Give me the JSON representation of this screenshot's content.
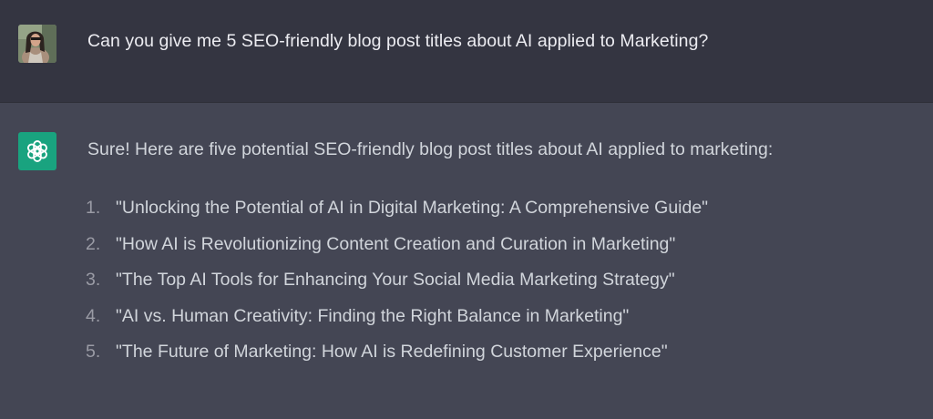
{
  "conversation": {
    "user_message": {
      "avatar": "user-photo-avatar",
      "text": "Can you give me 5 SEO-friendly blog post titles about AI applied to Marketing?"
    },
    "assistant_message": {
      "avatar": "openai-logo-icon",
      "intro": "Sure! Here are five potential SEO-friendly blog post titles about AI applied to marketing:",
      "items": [
        {
          "number": "1.",
          "text": "\"Unlocking the Potential of AI in Digital Marketing: A Comprehensive Guide\""
        },
        {
          "number": "2.",
          "text": "\"How AI is Revolutionizing Content Creation and Curation in Marketing\""
        },
        {
          "number": "3.",
          "text": "\"The Top AI Tools for Enhancing Your Social Media Marketing Strategy\""
        },
        {
          "number": "4.",
          "text": "\"AI vs. Human Creativity: Finding the Right Balance in Marketing\""
        },
        {
          "number": "5.",
          "text": "\"The Future of Marketing: How AI is Redefining Customer Experience\""
        }
      ]
    }
  },
  "colors": {
    "user_bg": "#343541",
    "assistant_bg": "#444654",
    "accent": "#19a37f",
    "text": "#ececf1"
  }
}
